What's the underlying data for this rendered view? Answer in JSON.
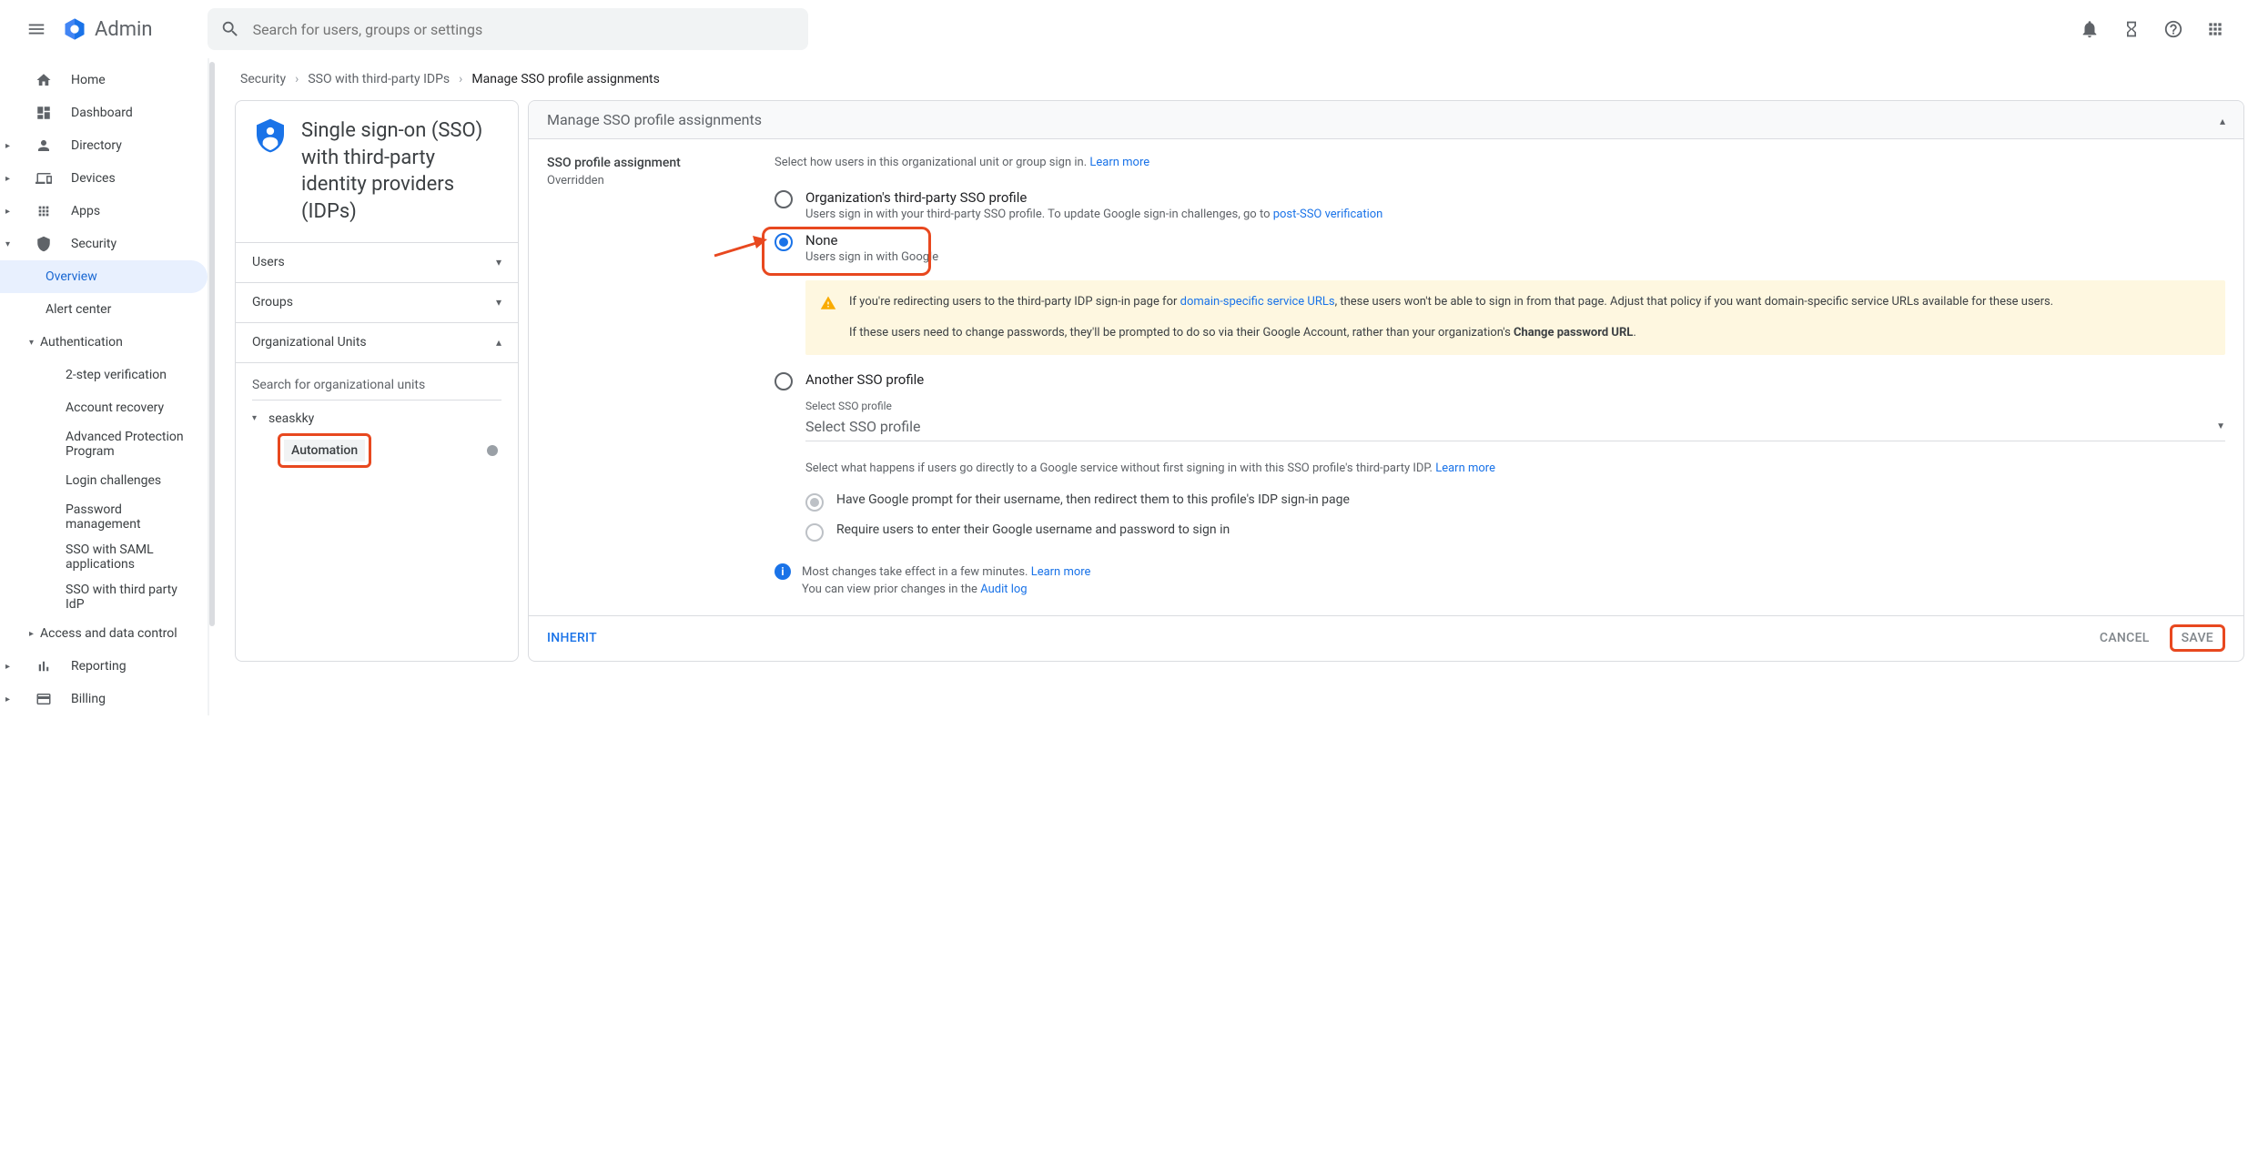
{
  "header": {
    "app_name": "Admin",
    "search_placeholder": "Search for users, groups or settings"
  },
  "sidebar": {
    "items": [
      {
        "label": "Home"
      },
      {
        "label": "Dashboard"
      },
      {
        "label": "Directory"
      },
      {
        "label": "Devices"
      },
      {
        "label": "Apps"
      },
      {
        "label": "Security"
      },
      {
        "label": "Reporting"
      },
      {
        "label": "Billing"
      }
    ],
    "security_children": [
      {
        "label": "Overview"
      },
      {
        "label": "Alert center"
      }
    ],
    "authentication_label": "Authentication",
    "auth_children": [
      {
        "label": "2-step verification"
      },
      {
        "label": "Account recovery"
      },
      {
        "label": "Advanced Protection Program"
      },
      {
        "label": "Login challenges"
      },
      {
        "label": "Password management"
      },
      {
        "label": "SSO with SAML applications"
      },
      {
        "label": "SSO with third party IdP"
      }
    ],
    "access_label": "Access and data control"
  },
  "breadcrumb": {
    "a": "Security",
    "b": "SSO with third-party IDPs",
    "c": "Manage SSO profile assignments"
  },
  "left_panel": {
    "title": "Single sign-on (SSO) with third-party identity providers (IDPs)",
    "rows": {
      "users": "Users",
      "groups": "Groups",
      "ou": "Organizational Units"
    },
    "search_label": "Search for organizational units",
    "ou_root": "seaskky",
    "ou_child": "Automation"
  },
  "right_panel": {
    "header": "Manage SSO profile assignments",
    "section_title": "SSO profile assignment",
    "section_sub": "Overridden",
    "intro": "Select how users in this organizational unit or group sign in. ",
    "learn_more": "Learn more",
    "opt1_title": "Organization's third-party SSO profile",
    "opt1_sub_prefix": "Users sign in with your third-party SSO profile. To update Google sign-in challenges, go to ",
    "opt1_link": "post-SSO verification",
    "opt2_title": "None",
    "opt2_sub": "Users sign in with Google",
    "warn_p1a": "If you're redirecting users to the third-party IDP sign-in page for ",
    "warn_link": "domain-specific service URLs",
    "warn_p1b": ", these users won't be able to sign in from that page. Adjust that policy if you want domain-specific service URLs available for these users.",
    "warn_p2a": "If these users need to change passwords, they'll be prompted to do so via their Google Account, rather than your organization's ",
    "warn_bold": "Change password URL",
    "warn_p2b": ".",
    "opt3_title": "Another SSO profile",
    "select_label": "Select SSO profile",
    "select_value": "Select SSO profile",
    "direct_text": "Select what happens if users go directly to a Google service without first signing in with this SSO profile's third-party IDP. ",
    "sub_opt1": "Have Google prompt for their username, then redirect them to this profile's IDP sign-in page",
    "sub_opt2": "Require users to enter their Google username and password to sign in",
    "info_l1a": "Most changes take effect in a few minutes. ",
    "info_l2a": "You can view prior changes in the ",
    "audit_link": "Audit log",
    "inherit": "INHERIT",
    "cancel": "CANCEL",
    "save": "SAVE"
  }
}
